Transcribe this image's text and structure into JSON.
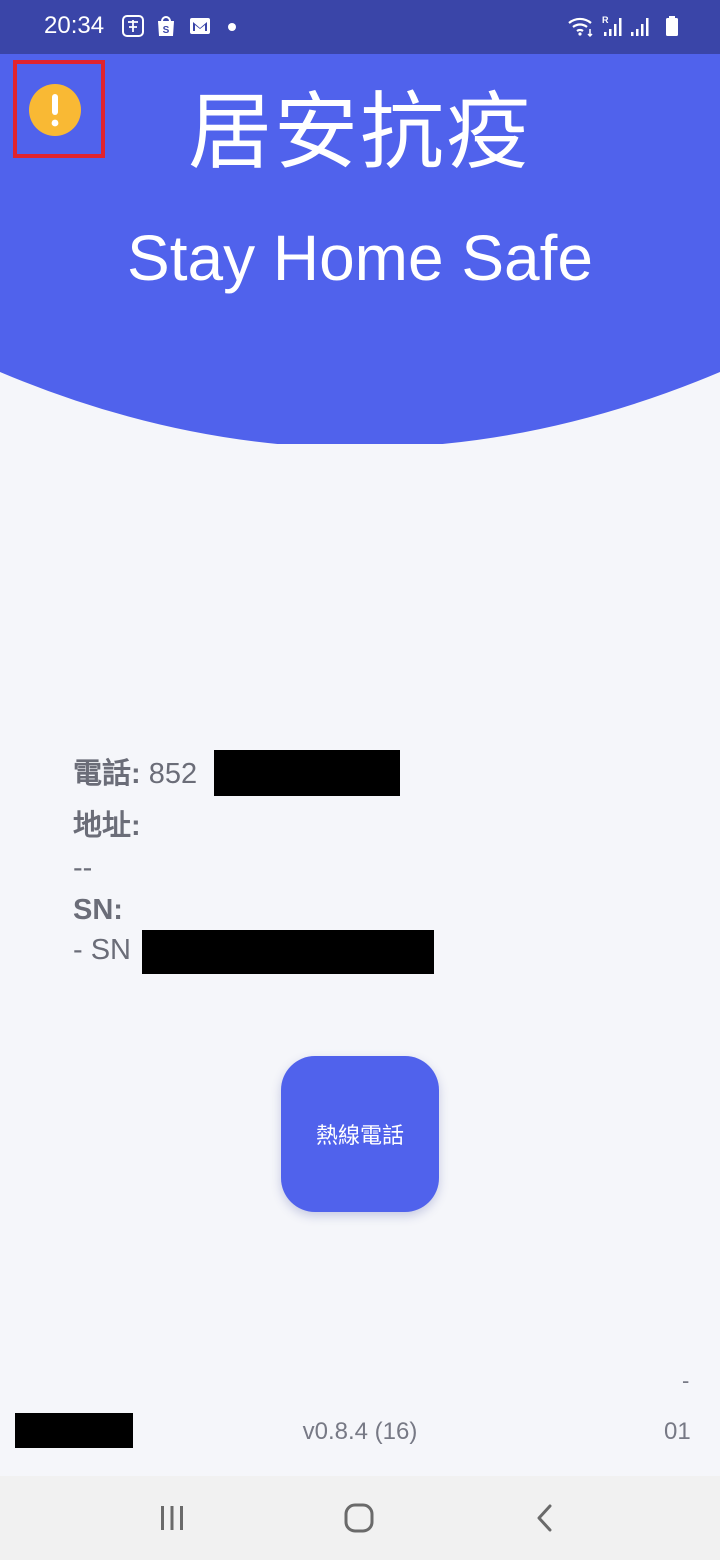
{
  "status_bar": {
    "time": "20:34",
    "left_icons": [
      "keyboard-char-icon",
      "shop-bag-icon",
      "gmail-icon",
      "notification-dot-icon"
    ],
    "right_icons": [
      "wifi-icon",
      "signal-roaming-icon",
      "signal-icon",
      "battery-icon"
    ]
  },
  "header": {
    "title_zh": "居安抗疫",
    "title_en": "Stay Home Safe",
    "background_color": "#5062ec",
    "warning_icon": "warning-icon",
    "warning_color": "#f9b934",
    "highlight_color": "#e1232d"
  },
  "info": {
    "phone_label": "電話:",
    "phone_value": "852",
    "address_label": "地址:",
    "address_value": "--",
    "sn_label": "SN:",
    "sn_value": "- SN"
  },
  "hotline_button": {
    "label": "熱線電話",
    "color": "#5062ec"
  },
  "footer": {
    "version": "v0.8.4 (16)",
    "right_dash": "-",
    "right_text": "01"
  },
  "nav_bar": {
    "buttons": [
      "recent-apps-icon",
      "home-icon",
      "back-icon"
    ]
  }
}
